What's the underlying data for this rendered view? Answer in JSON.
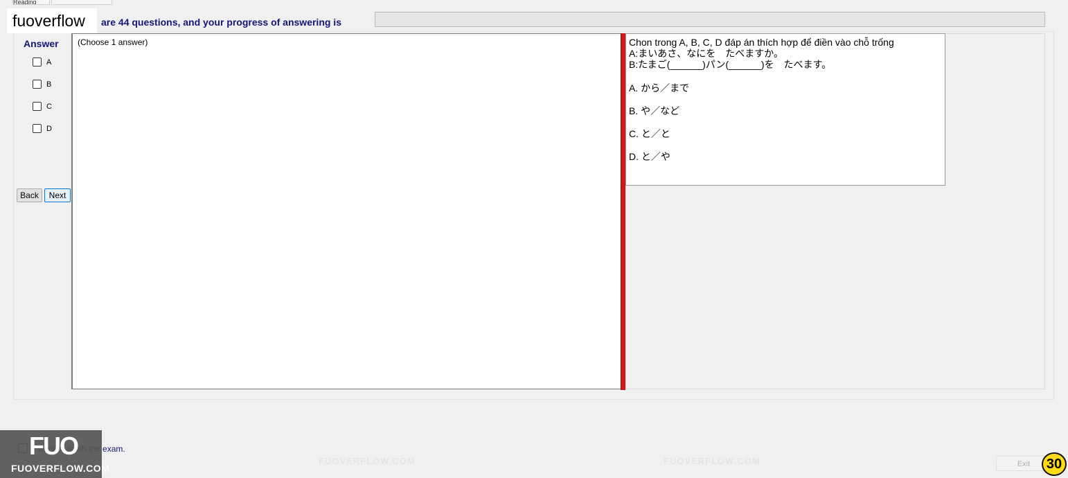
{
  "window": {
    "tabs": [
      "Reading",
      ""
    ]
  },
  "brand": {
    "label": "fuoverflow"
  },
  "progress": {
    "text": "are 44 questions, and your progress of answering is"
  },
  "answer_panel": {
    "title": "Answer",
    "options": [
      "A",
      "B",
      "C",
      "D"
    ],
    "hint": "(Choose 1 answer)"
  },
  "nav": {
    "back_label": "Back",
    "next_label": "Next"
  },
  "question": {
    "lines": [
      "Chon trong A, B, C, D đáp án thích hợp để điền vào chỗ trống",
      "A:まいあさ、なにを　たべますか。",
      "B:たまご(______)パン(______)を　たべます。"
    ],
    "options": [
      "A.  から／まで",
      "B.  や／など",
      "C.  と／と",
      "D.  と／や"
    ]
  },
  "watermark": {
    "text": "FUOVERFLOW.COM"
  },
  "footer": {
    "finish_text": "I want to finish the exam.",
    "exit_label": "Exit",
    "counter": "30",
    "badge_logo": "FUO",
    "badge_text": "FUOVERFLOW.COM"
  }
}
